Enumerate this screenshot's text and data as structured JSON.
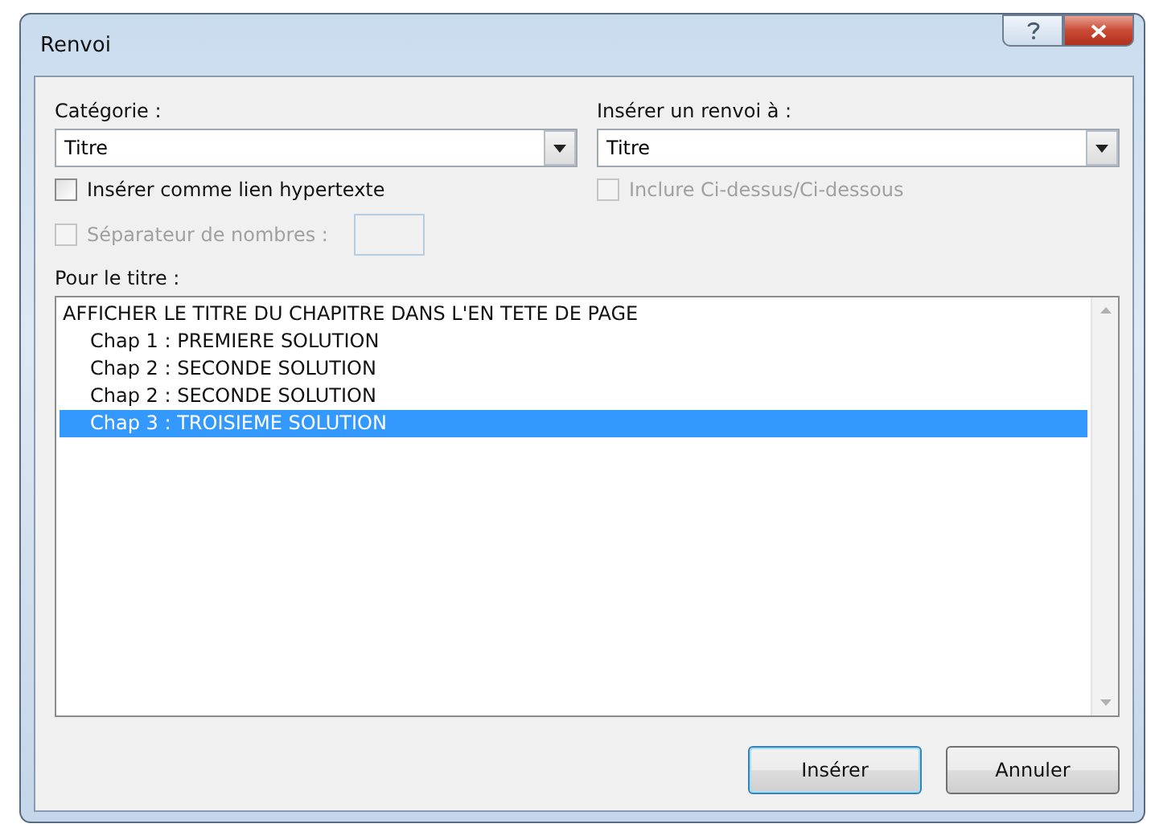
{
  "window": {
    "title": "Renvoi"
  },
  "category": {
    "label": "Catégorie :",
    "value": "Titre"
  },
  "reference_to": {
    "label": "Insérer un renvoi à :",
    "value": "Titre"
  },
  "options": [
    {
      "label": "Insérer comme lien hypertexte",
      "checked": false,
      "disabled": false
    },
    {
      "label": "Inclure Ci-dessus/Ci-dessous",
      "checked": false,
      "disabled": true
    },
    {
      "label": "Séparateur de nombres :",
      "checked": false,
      "disabled": true
    }
  ],
  "list": {
    "label": "Pour le titre :",
    "items": [
      {
        "text": "AFFICHER LE TITRE DU CHAPITRE DANS L'EN TETE DE PAGE",
        "selected": false,
        "children": [
          {
            "text": "Chap 1 : PREMIERE SOLUTION",
            "selected": false
          },
          {
            "text": "Chap 2 : SECONDE SOLUTION",
            "selected": false
          },
          {
            "text": "Chap 2 : SECONDE SOLUTION",
            "selected": false
          },
          {
            "text": "Chap 3 : TROISIEME SOLUTION",
            "selected": true
          }
        ]
      }
    ]
  },
  "buttons": [
    {
      "label": "Insérer",
      "default": true
    },
    {
      "label": "Annuler",
      "default": false
    }
  ]
}
